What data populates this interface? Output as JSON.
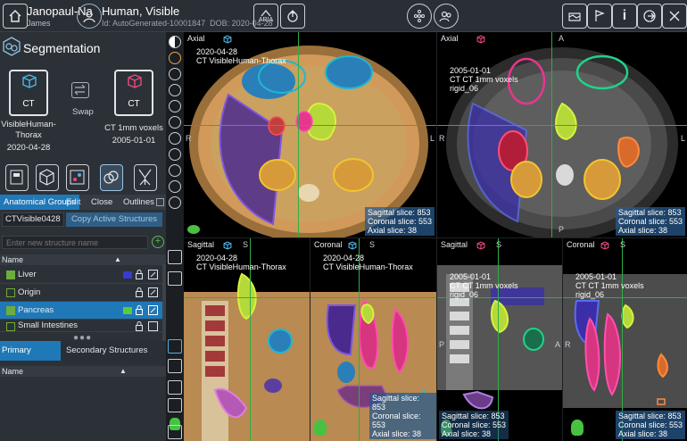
{
  "header": {
    "patient_name": "Janopaul-Na",
    "patient_first": "James",
    "study_name": "Human, Visible",
    "study_id": "Id: AutoGenerated-10001847",
    "study_dob": "DOB: 2020-04-28",
    "aria_label": "ARIA"
  },
  "segmentation": {
    "title": "Segmentation",
    "primary_volume": {
      "modality": "CT",
      "name": "VisibleHuman-Thorax",
      "date": "2020-04-28"
    },
    "secondary_volume": {
      "modality": "CT",
      "name": "CT 1mm voxels",
      "date": "2005-01-01"
    },
    "swap_label": "Swap"
  },
  "tabs": {
    "groups": "Anatomical Groups",
    "edit": "Edit",
    "close": "Close",
    "outlines": "Outlines"
  },
  "structure_set_name": "CTVisible0428",
  "copy_button": "Copy Active Structures",
  "new_structure_placeholder": "Enter new structure name",
  "list_header": "Name",
  "structures": [
    {
      "name": "Liver",
      "checked": true,
      "color": "#3a3ad0",
      "selected": false
    },
    {
      "name": "Origin",
      "checked": false,
      "color": "",
      "selected": false
    },
    {
      "name": "Pancreas",
      "checked": true,
      "color": "#5acb3c",
      "selected": true
    },
    {
      "name": "Small Intestines",
      "checked": false,
      "color": "",
      "selected": false
    }
  ],
  "bottom_tabs": {
    "primary": "Primary Structures",
    "secondary": "Secondary Structures"
  },
  "bottom_list_header": "Name",
  "viewports": {
    "axial_primary": {
      "view": "Axial",
      "date": "2020-04-28",
      "series": "CT VisibleHuman-Thorax",
      "sag": "Sagittal slice: 853",
      "cor": "Coronal slice: 553",
      "ax": "Axial slice: 38"
    },
    "axial_secondary": {
      "view": "Axial",
      "date": "2005-01-01",
      "series": "CT CT 1mm voxels",
      "reg": "rigid_06",
      "sag": "Sagittal slice: 853",
      "cor": "Coronal slice: 553",
      "ax": "Axial slice: 38"
    },
    "sag_primary": {
      "view": "Sagittal",
      "date": "2020-04-28",
      "series": "CT VisibleHuman-Thorax"
    },
    "cor_primary": {
      "view": "Coronal",
      "date": "2020-04-28",
      "series": "CT VisibleHuman-Thorax",
      "sag": "Sagittal slice: 853",
      "cor": "Coronal slice: 553",
      "ax": "Axial slice: 38"
    },
    "sag_secondary": {
      "view": "Sagittal",
      "date": "2005-01-01",
      "series": "CT CT 1mm voxels",
      "reg": "rigid_06",
      "sag": "Sagittal slice: 853",
      "cor": "Coronal slice: 553",
      "ax": "Axial slice: 38"
    },
    "cor_secondary": {
      "view": "Coronal",
      "date": "2005-01-01",
      "series": "CT CT 1mm voxels",
      "reg": "rigid_06",
      "sag": "Sagittal slice: 853",
      "cor": "Coronal slice: 553",
      "ax": "Axial slice: 38"
    }
  },
  "orientation": {
    "A": "A",
    "P": "P",
    "R": "R",
    "L": "L",
    "S": "S"
  }
}
